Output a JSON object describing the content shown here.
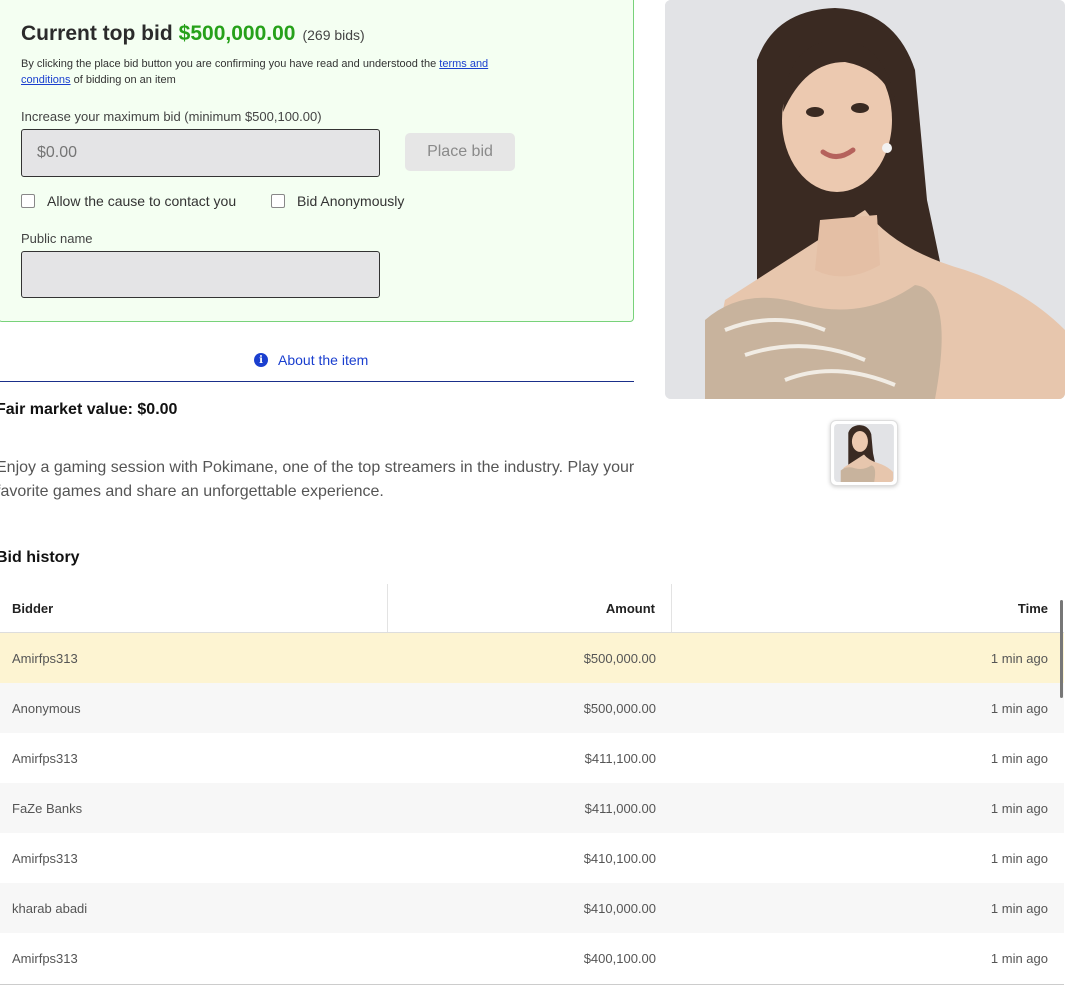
{
  "bid_panel": {
    "title_label": "Current top bid",
    "top_bid": "$500,000.00",
    "bid_count": "(269 bids)",
    "disclaimer_before": "By clicking the place bid button you are confirming you have read and understood the ",
    "terms_link": "terms and conditions",
    "disclaimer_after": " of bidding on an item",
    "increase_label": "Increase your maximum bid (minimum $500,100.00)",
    "bid_placeholder": "$0.00",
    "place_bid_label": "Place bid",
    "contact_label": "Allow the cause to contact you",
    "anonymous_label": "Bid Anonymously",
    "public_name_label": "Public name"
  },
  "about_tab": {
    "label": "About the item"
  },
  "item": {
    "fair_market_value": "Fair market value: $0.00",
    "description": "Enjoy a gaming session with Pokimane, one of the top streamers in the industry. Play your favorite games and share an unforgettable experience."
  },
  "bid_history": {
    "title": "Bid history",
    "columns": {
      "bidder": "Bidder",
      "amount": "Amount",
      "time": "Time"
    },
    "rows": [
      {
        "bidder": "Amirfps313",
        "amount": "$500,000.00",
        "time": "1 min ago"
      },
      {
        "bidder": "Anonymous",
        "amount": "$500,000.00",
        "time": "1 min ago"
      },
      {
        "bidder": "Amirfps313",
        "amount": "$411,100.00",
        "time": "1 min ago"
      },
      {
        "bidder": "FaZe Banks",
        "amount": "$411,000.00",
        "time": "1 min ago"
      },
      {
        "bidder": "Amirfps313",
        "amount": "$410,100.00",
        "time": "1 min ago"
      },
      {
        "bidder": "kharab abadi",
        "amount": "$410,000.00",
        "time": "1 min ago"
      },
      {
        "bidder": "Amirfps313",
        "amount": "$400,100.00",
        "time": "1 min ago"
      }
    ]
  },
  "colors": {
    "accent_green": "#26a11a",
    "link_blue": "#1a3fcf",
    "panel_bg": "#f4fff2",
    "highlight_row": "#fdf4d2"
  },
  "icons": {
    "about": "info-icon"
  }
}
